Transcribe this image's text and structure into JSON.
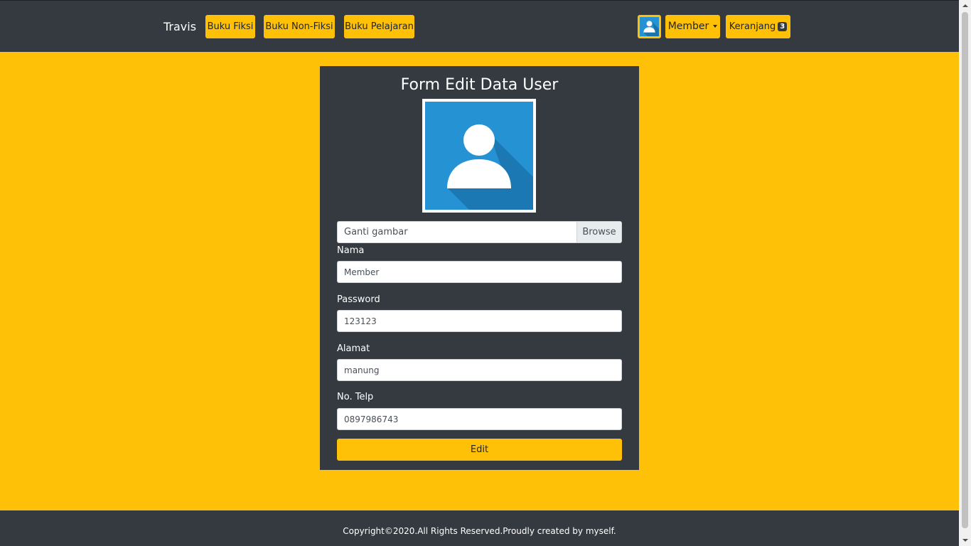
{
  "navbar": {
    "brand": "Travis",
    "links": [
      {
        "label": "Buku Fiksi"
      },
      {
        "label": "Buku Non-Fiksi"
      },
      {
        "label": "Buku Pelajaran"
      }
    ],
    "user_menu_label": "Member",
    "cart_label": "Keranjang",
    "cart_count": "3"
  },
  "form": {
    "title": "Form Edit Data User",
    "file_placeholder": "Ganti gambar",
    "browse_label": "Browse",
    "fields": {
      "nama": {
        "label": "Nama",
        "value": "Member"
      },
      "password": {
        "label": "Password",
        "value": "123123"
      },
      "alamat": {
        "label": "Alamat",
        "value": "manung"
      },
      "telp": {
        "label": "No. Telp",
        "value": "0897986743"
      }
    },
    "submit_label": "Edit"
  },
  "footer": {
    "text": "Copyright©2020.All Rights Reserved.Proudly created by myself."
  },
  "colors": {
    "accent": "#ffc107",
    "dark": "#343a40",
    "avatar_bg": "#2492d3"
  }
}
